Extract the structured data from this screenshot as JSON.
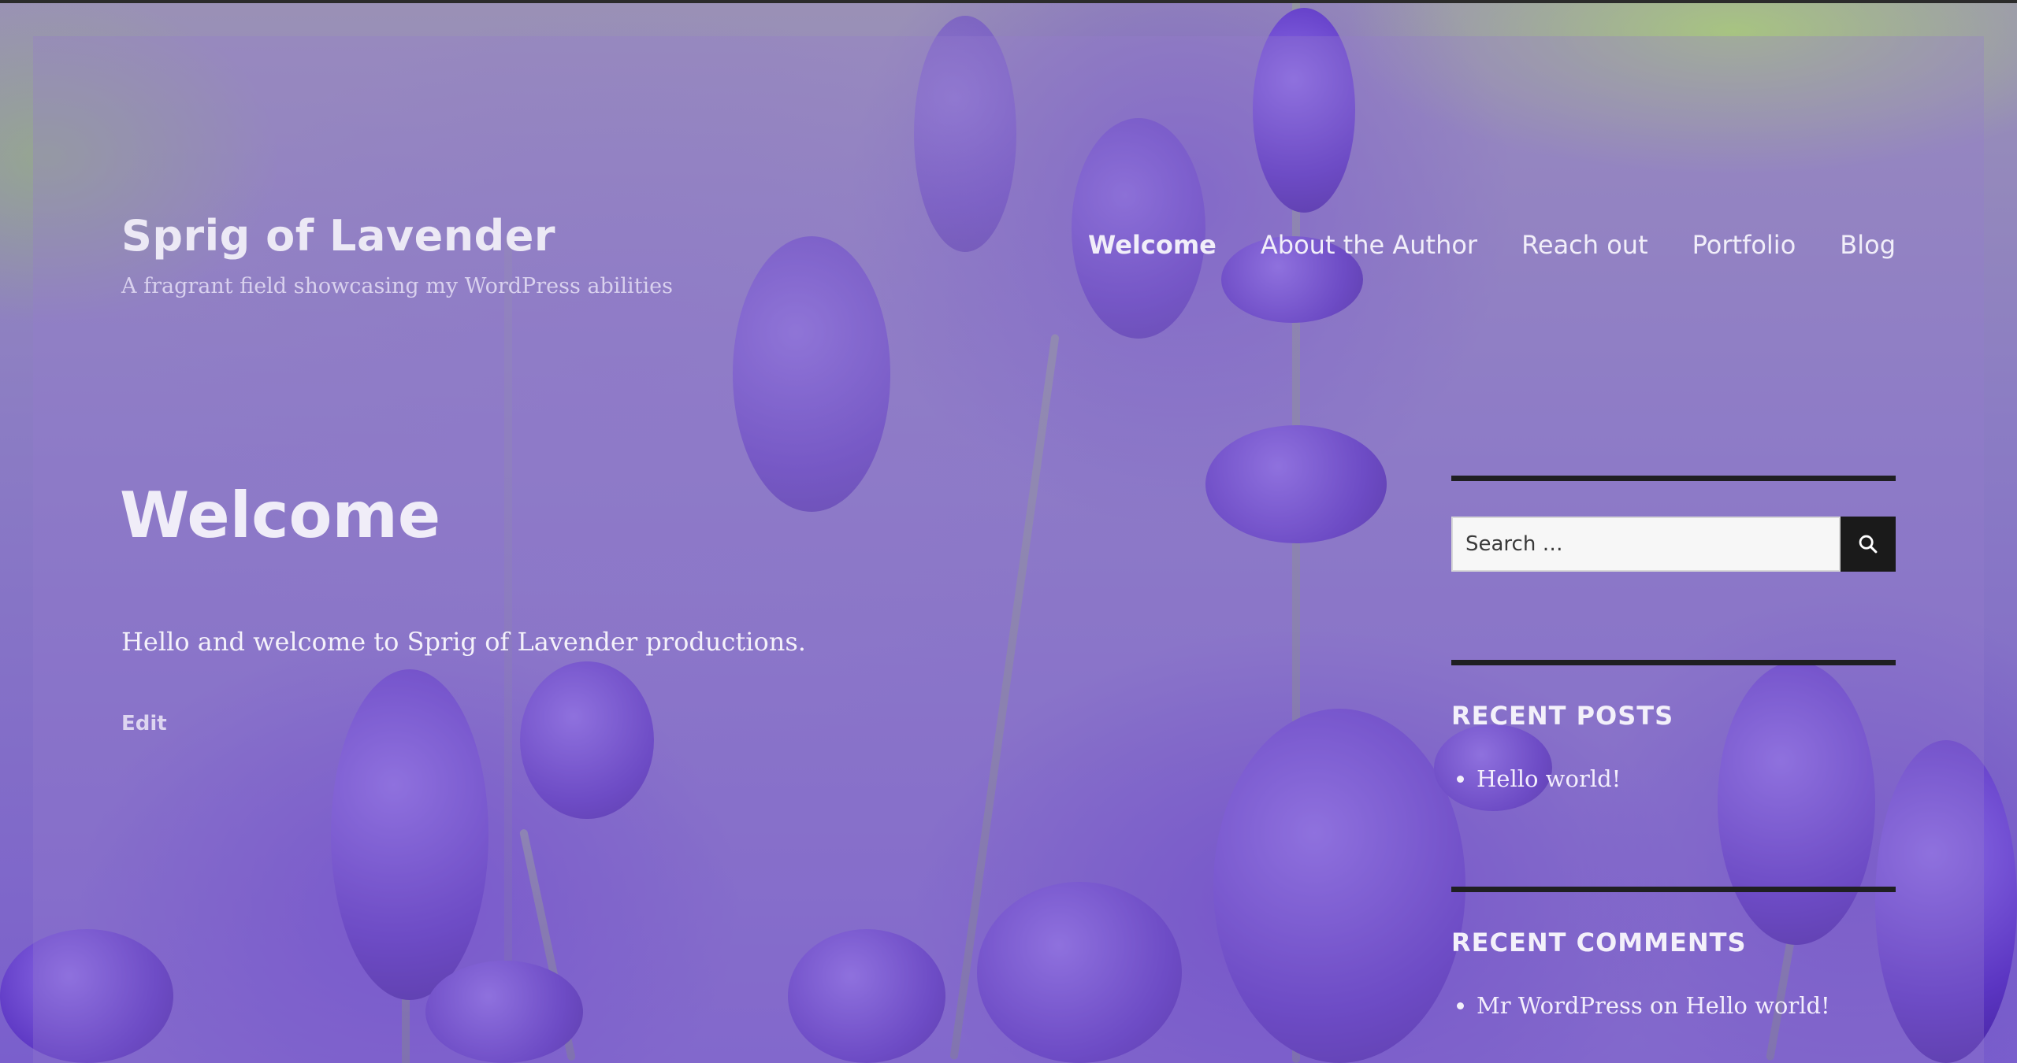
{
  "site": {
    "title": "Sprig of Lavender",
    "tagline": "A fragrant field showcasing my WordPress abilities"
  },
  "nav": {
    "items": [
      {
        "label": "Welcome",
        "current": true
      },
      {
        "label": "About the Author",
        "current": false
      },
      {
        "label": "Reach out",
        "current": false
      },
      {
        "label": "Portfolio",
        "current": false
      },
      {
        "label": "Blog",
        "current": false
      }
    ]
  },
  "main": {
    "title": "Welcome",
    "body": "Hello and welcome to Sprig of Lavender productions.",
    "edit_label": "Edit"
  },
  "sidebar": {
    "search": {
      "placeholder": "Search …",
      "button_icon": "search-icon"
    },
    "recent_posts": {
      "title": "RECENT POSTS",
      "items": [
        {
          "label": "Hello world!"
        }
      ]
    },
    "recent_comments": {
      "title": "RECENT COMMENTS",
      "items": [
        {
          "author": "Mr WordPress",
          "connector": "on",
          "post": "Hello world!"
        }
      ]
    }
  },
  "colors": {
    "accent_dark": "#1a1a1a",
    "text_light": "#f3f0fa",
    "overlay_lavender": "#967dcd"
  }
}
